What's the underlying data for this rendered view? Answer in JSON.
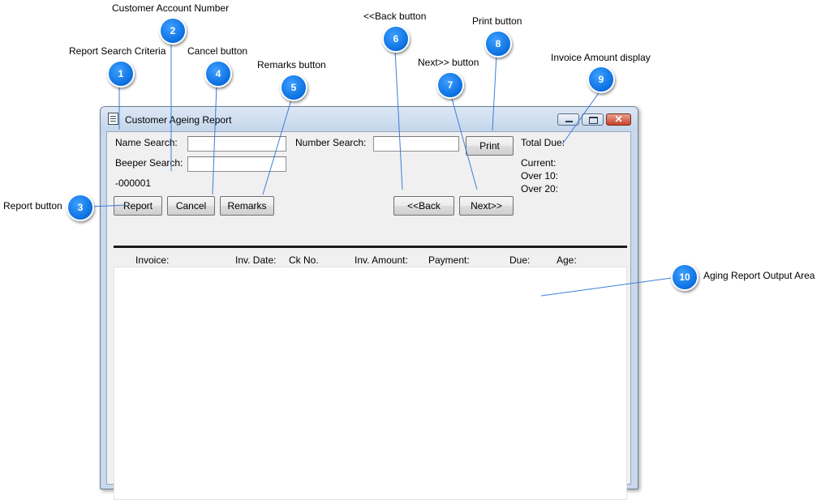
{
  "window": {
    "title": "Customer Ageing Report"
  },
  "form": {
    "name_search_label": "Name Search:",
    "beeper_search_label": "Beeper Search:",
    "number_search_label": "Number Search:",
    "name_search_value": "",
    "beeper_search_value": "",
    "number_search_value": "",
    "account_number": "-000001",
    "total_due_label": "Total Due:",
    "current_label": "Current:",
    "over10_label": "Over 10:",
    "over20_label": "Over 20:"
  },
  "buttons": {
    "print": "Print",
    "report": "Report",
    "cancel": "Cancel",
    "remarks": "Remarks",
    "back": "<<Back",
    "next": "Next>>"
  },
  "columns": [
    "Invoice:",
    "Inv. Date:",
    "Ck No.",
    "Inv. Amount:",
    "Payment:",
    "Due:",
    "Age:"
  ],
  "callouts": [
    {
      "number": "1",
      "label": "Report Search Criteria"
    },
    {
      "number": "2",
      "label": "Customer Account Number"
    },
    {
      "number": "3",
      "label": "Report button"
    },
    {
      "number": "4",
      "label": "Cancel button"
    },
    {
      "number": "5",
      "label": "Remarks button"
    },
    {
      "number": "6",
      "label": "<<Back button"
    },
    {
      "number": "7",
      "label": "Next>> button"
    },
    {
      "number": "8",
      "label": "Print button"
    },
    {
      "number": "9",
      "label": "Invoice Amount display"
    },
    {
      "number": "10",
      "label": "Aging Report Output Area"
    }
  ],
  "colors": {
    "callout_blue": "#0a6fe0",
    "window_frame": "#c9d8ea",
    "close_red": "#c7432a"
  }
}
